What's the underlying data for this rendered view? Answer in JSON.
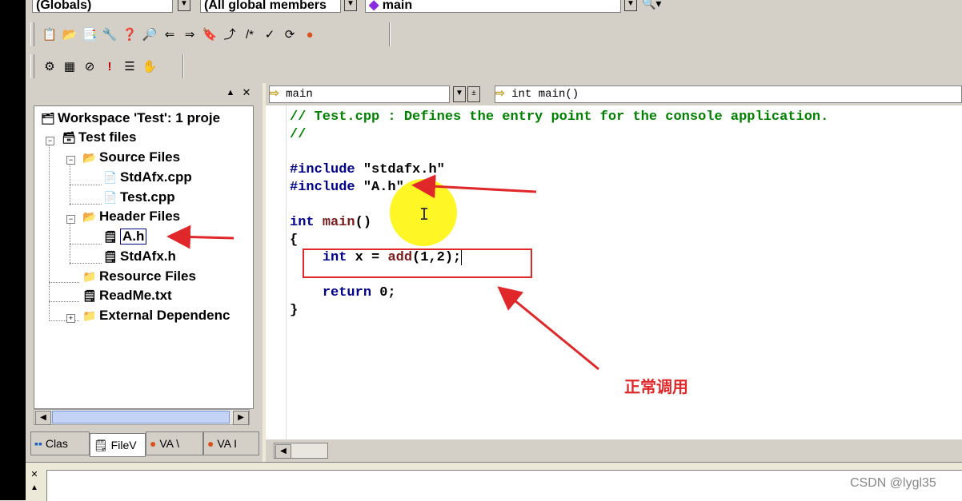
{
  "toolbar": {
    "scope_combo": "(Globals)",
    "members_combo": "(All global members",
    "function_combo": "main",
    "row1_icons": [
      "open-workspace-icon",
      "open-folder-icon",
      "copy-icon",
      "tools-icon",
      "help-icon",
      "find-icon",
      "back-icon",
      "forward-icon",
      "bookmark-icon",
      "goto-icon",
      "comment-icon",
      "spell-icon",
      "refresh-icon",
      "tomato-icon"
    ],
    "row2_icons": [
      "compile-icon",
      "build-icon",
      "stop-build-icon",
      "execute-icon",
      "list-icon",
      "hand-icon"
    ]
  },
  "workspace": {
    "items": [
      {
        "label": "Workspace 'Test': 1 proje",
        "icon": "workspace-icon"
      },
      {
        "label": "Test files",
        "icon": "project-icon"
      },
      {
        "label": "Source Files",
        "icon": "folder-icon"
      },
      {
        "label": "StdAfx.cpp",
        "icon": "cpp-file-icon"
      },
      {
        "label": "Test.cpp",
        "icon": "cpp-file-icon"
      },
      {
        "label": "Header Files",
        "icon": "folder-icon"
      },
      {
        "label": "A.h",
        "icon": "header-file-icon"
      },
      {
        "label": "StdAfx.h",
        "icon": "header-file-icon"
      },
      {
        "label": "Resource Files",
        "icon": "folder-icon"
      },
      {
        "label": "ReadMe.txt",
        "icon": "text-file-icon"
      },
      {
        "label": "External Dependenc",
        "icon": "folder-icon"
      }
    ],
    "tabs": [
      "Clas",
      "FileV",
      "VA \\",
      "VA I"
    ]
  },
  "editor": {
    "class_combo": "main",
    "function_combo": "int main()",
    "code": [
      "// Test.cpp : Defines the entry point for the console application.",
      "//",
      "",
      "#include \"stdafx.h\"",
      "#include \"A.h\"",
      "",
      "int main()",
      "{",
      "    int x = add(1,2);",
      "",
      "    return 0;",
      "}"
    ]
  },
  "annotation": {
    "text": "正常调用",
    "color": "#e0282a"
  },
  "watermark": "CSDN @lygl35"
}
